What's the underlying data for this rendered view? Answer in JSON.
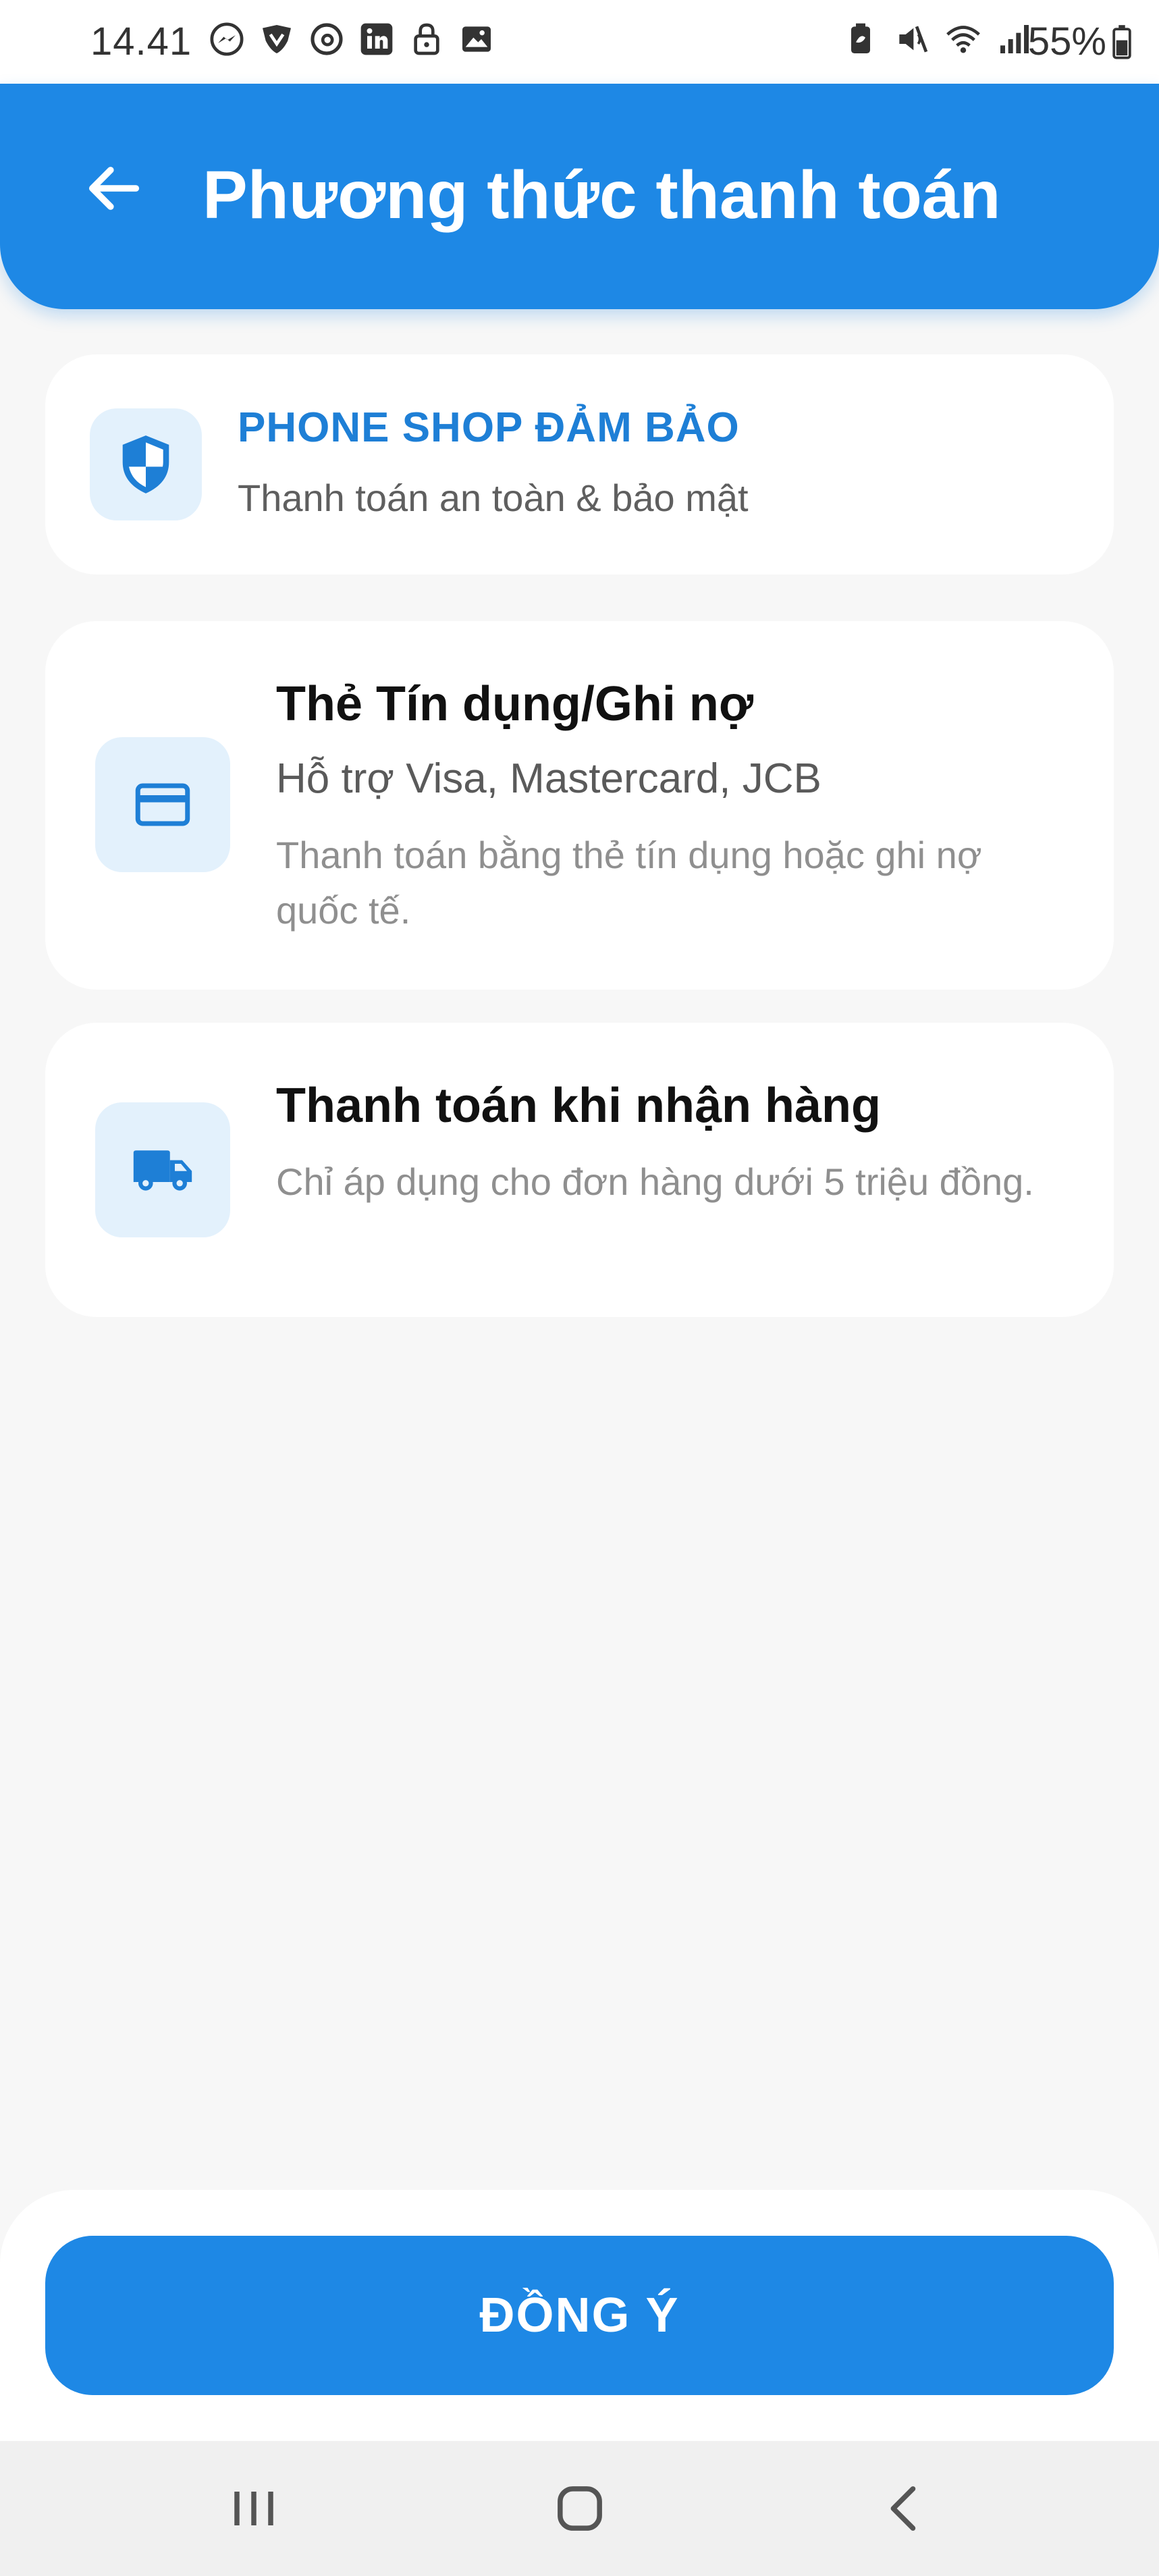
{
  "status_bar": {
    "time": "14.41",
    "battery": "55%",
    "left_icons": [
      "messenger-icon",
      "vpn-shield-icon",
      "threads-icon",
      "linkedin-icon",
      "lock-icon",
      "image-icon"
    ],
    "right_icons": [
      "battery-saver-icon",
      "mute-icon",
      "wifi-icon",
      "signal-icon"
    ]
  },
  "app_bar": {
    "title": "Phương thức thanh toán",
    "back_icon": "arrow-left-icon"
  },
  "guarantee": {
    "title": "PHONE SHOP ĐẢM BẢO",
    "subtitle": "Thanh toán an toàn & bảo mật",
    "icon": "shield-icon"
  },
  "options": [
    {
      "title": "Thẻ Tín dụng/Ghi nợ",
      "subtitle": "Hỗ trợ Visa, Mastercard, JCB",
      "description": "Thanh toán bằng thẻ tín dụng hoặc ghi nợ quốc tế.",
      "icon": "credit-card-icon"
    },
    {
      "title": "Thanh toán khi nhận hàng",
      "description": "Chỉ áp dụng cho đơn hàng dưới 5 triệu đồng.",
      "icon": "delivery-truck-icon"
    }
  ],
  "confirm_button": {
    "label": "ĐỒNG Ý"
  },
  "colors": {
    "primary": "#1e88e5",
    "icon_bg": "#e3f1fc",
    "background": "#f7f7f7"
  }
}
